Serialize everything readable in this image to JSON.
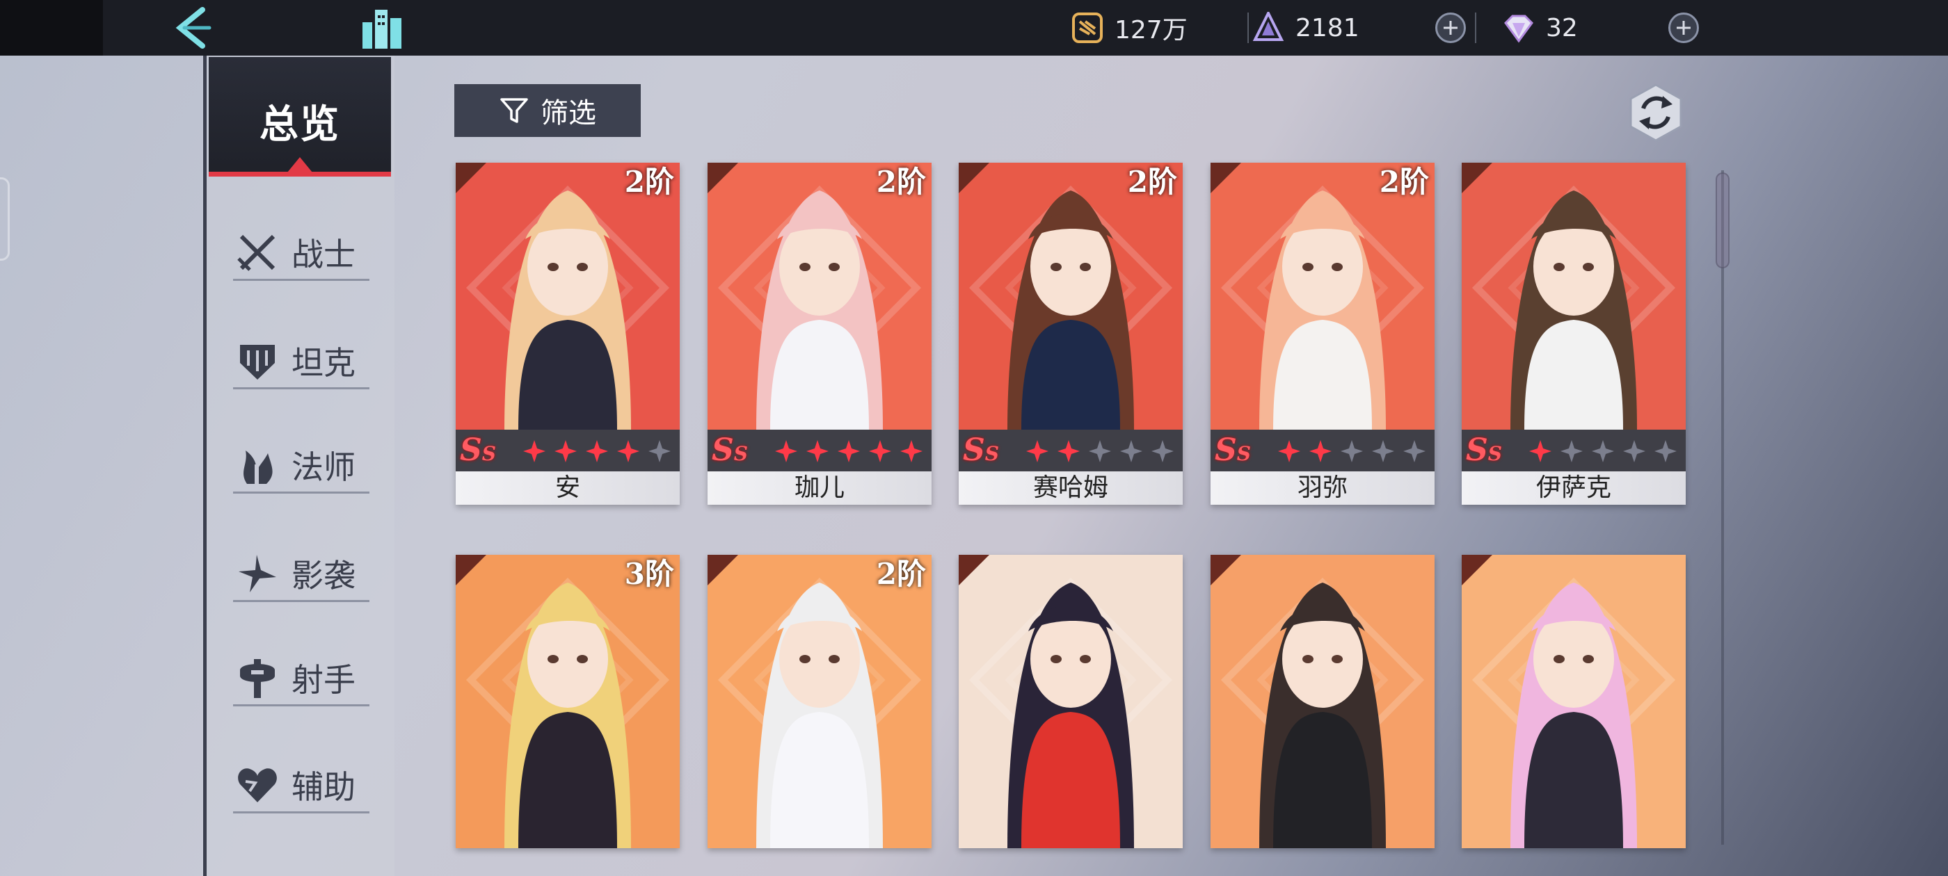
{
  "header": {
    "resources": [
      {
        "name": "gold",
        "icon": "gold-coin-icon",
        "value": "127万"
      },
      {
        "name": "crystal",
        "icon": "crystal-icon",
        "value": "2181"
      },
      {
        "name": "gem",
        "icon": "diamond-icon",
        "value": "32"
      }
    ]
  },
  "sidebar": {
    "overview_label": "总览",
    "categories": [
      {
        "label": "战士",
        "icon": "crossed-swords-icon"
      },
      {
        "label": "坦克",
        "icon": "shield-icon"
      },
      {
        "label": "法师",
        "icon": "flame-staff-icon"
      },
      {
        "label": "影袭",
        "icon": "shuriken-icon"
      },
      {
        "label": "射手",
        "icon": "crosshair-icon"
      },
      {
        "label": "辅助",
        "icon": "heart-icon"
      }
    ]
  },
  "toolbar": {
    "filter_label": "筛选"
  },
  "characters": [
    {
      "name": "安",
      "rank": "2阶",
      "grade": "S",
      "stars_lit": 4,
      "stars_total": 5
    },
    {
      "name": "珈儿",
      "rank": "2阶",
      "grade": "S",
      "stars_lit": 5,
      "stars_total": 5
    },
    {
      "name": "赛哈姆",
      "rank": "2阶",
      "grade": "S",
      "stars_lit": 2,
      "stars_total": 5
    },
    {
      "name": "羽弥",
      "rank": "2阶",
      "grade": "S",
      "stars_lit": 2,
      "stars_total": 5
    },
    {
      "name": "伊萨克",
      "rank": "",
      "grade": "S",
      "stars_lit": 1,
      "stars_total": 5
    },
    {
      "name": "",
      "rank": "3阶",
      "grade": "",
      "stars_lit": 0,
      "stars_total": 0
    },
    {
      "name": "",
      "rank": "2阶",
      "grade": "",
      "stars_lit": 0,
      "stars_total": 0
    },
    {
      "name": "",
      "rank": "",
      "grade": "",
      "stars_lit": 0,
      "stars_total": 0
    },
    {
      "name": "",
      "rank": "",
      "grade": "",
      "stars_lit": 0,
      "stars_total": 0
    },
    {
      "name": "",
      "rank": "",
      "grade": "",
      "stars_lit": 0,
      "stars_total": 0
    }
  ],
  "colors": {
    "accent_red": "#e23a46",
    "panel_dark": "#1f2129"
  }
}
